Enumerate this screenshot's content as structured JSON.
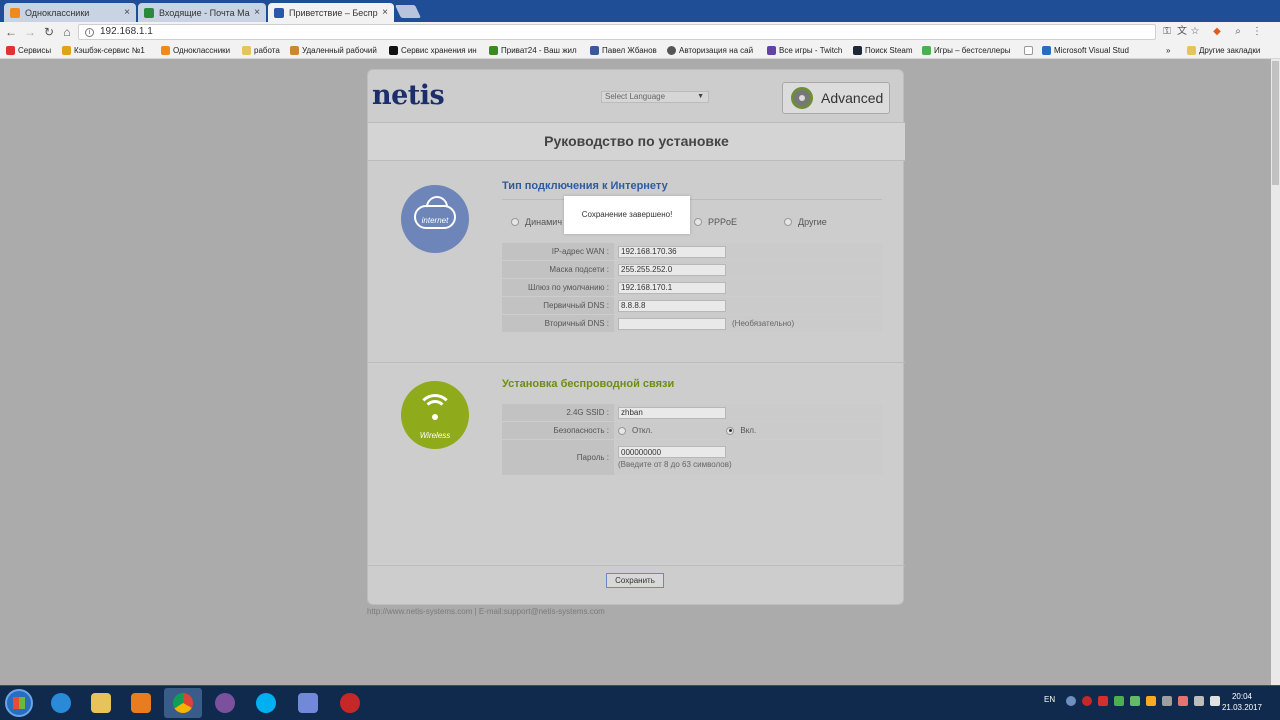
{
  "browser": {
    "tabs": [
      {
        "title": "Одноклассники",
        "color": "#f08a1c",
        "active": false
      },
      {
        "title": "Входящие - Почта Mail.",
        "color": "#2b8a3e",
        "active": false
      },
      {
        "title": "Приветствие – Беспро",
        "color": "#2a58a8",
        "active": true
      }
    ],
    "url": "192.168.1.1",
    "bookmarks": [
      {
        "label": "Сервисы",
        "color": "#d33"
      },
      {
        "label": "Кэшбэк-сервис №1",
        "color": "#e0a21b"
      },
      {
        "label": "Одноклассники",
        "color": "#f08a1c"
      },
      {
        "label": "работа",
        "color": "#e8c35a"
      },
      {
        "label": "Удаленный рабочий",
        "color": "#c98a2f"
      },
      {
        "label": "Сервис хранения ин",
        "color": "#111"
      },
      {
        "label": "Приват24 - Ваш жил",
        "color": "#3a8a1f"
      },
      {
        "label": "Павел Жбанов",
        "color": "#3b5998"
      },
      {
        "label": "Авторизация на сай",
        "color": "#555"
      },
      {
        "label": "Все игры - Twitch",
        "color": "#6441a4"
      },
      {
        "label": "Поиск Steam",
        "color": "#1b2838"
      },
      {
        "label": "Игры – бестселлеры",
        "color": "#4caf50"
      },
      {
        "label": "",
        "color": "#999"
      },
      {
        "label": "Microsoft Visual Stud",
        "color": "#2a6cbf"
      },
      {
        "label": "»",
        "color": ""
      },
      {
        "label": "Другие закладки",
        "color": "#e8c35a"
      }
    ]
  },
  "router": {
    "logo": "netis",
    "language_select": "Select Language",
    "advanced_label": "Advanced",
    "page_title": "Руководство по установке",
    "internet": {
      "icon_text": "internet",
      "title": "Тип подключения к Интернету",
      "options": [
        "Динамич",
        "PPPoE",
        "Другие"
      ],
      "fields": [
        {
          "label": "IP-адрес WAN :",
          "value": "192.168.170.36",
          "note": ""
        },
        {
          "label": "Маска подсети :",
          "value": "255.255.252.0",
          "note": ""
        },
        {
          "label": "Шлюз по умолчанию :",
          "value": "192.168.170.1",
          "note": ""
        },
        {
          "label": "Первичный DNS :",
          "value": "8.8.8.8",
          "note": ""
        },
        {
          "label": "Вторичный DNS :",
          "value": "",
          "note": "(Необязательно)"
        }
      ]
    },
    "wireless": {
      "icon_text": "Wireless",
      "title": "Установка беспроводной связи",
      "ssid_label": "2.4G SSID :",
      "ssid_value": "zhban",
      "security_label": "Безопасность :",
      "security_off": "Откл.",
      "security_on": "Вкл.",
      "password_label": "Пароль :",
      "password_value": "000000000",
      "password_hint": "(Введите от 8 до 63 символов)"
    },
    "save_button": "Сохранить",
    "toast": "Сохранение завершено!",
    "footer": "http://www.netis-systems.com | E-mail:support@netis-systems.com"
  },
  "taskbar": {
    "apps": [
      {
        "name": "ie",
        "color": "#2a8ad8"
      },
      {
        "name": "explorer",
        "color": "#e8c35a"
      },
      {
        "name": "media",
        "color": "#e87c1e"
      },
      {
        "name": "chrome",
        "color": "#4caf50"
      },
      {
        "name": "viber",
        "color": "#7b519d"
      },
      {
        "name": "skype",
        "color": "#00aff0"
      },
      {
        "name": "discord",
        "color": "#7289da"
      },
      {
        "name": "recorder",
        "color": "#c62828"
      }
    ],
    "lang": "EN",
    "time": "20:04",
    "date": "21.03.2017"
  }
}
